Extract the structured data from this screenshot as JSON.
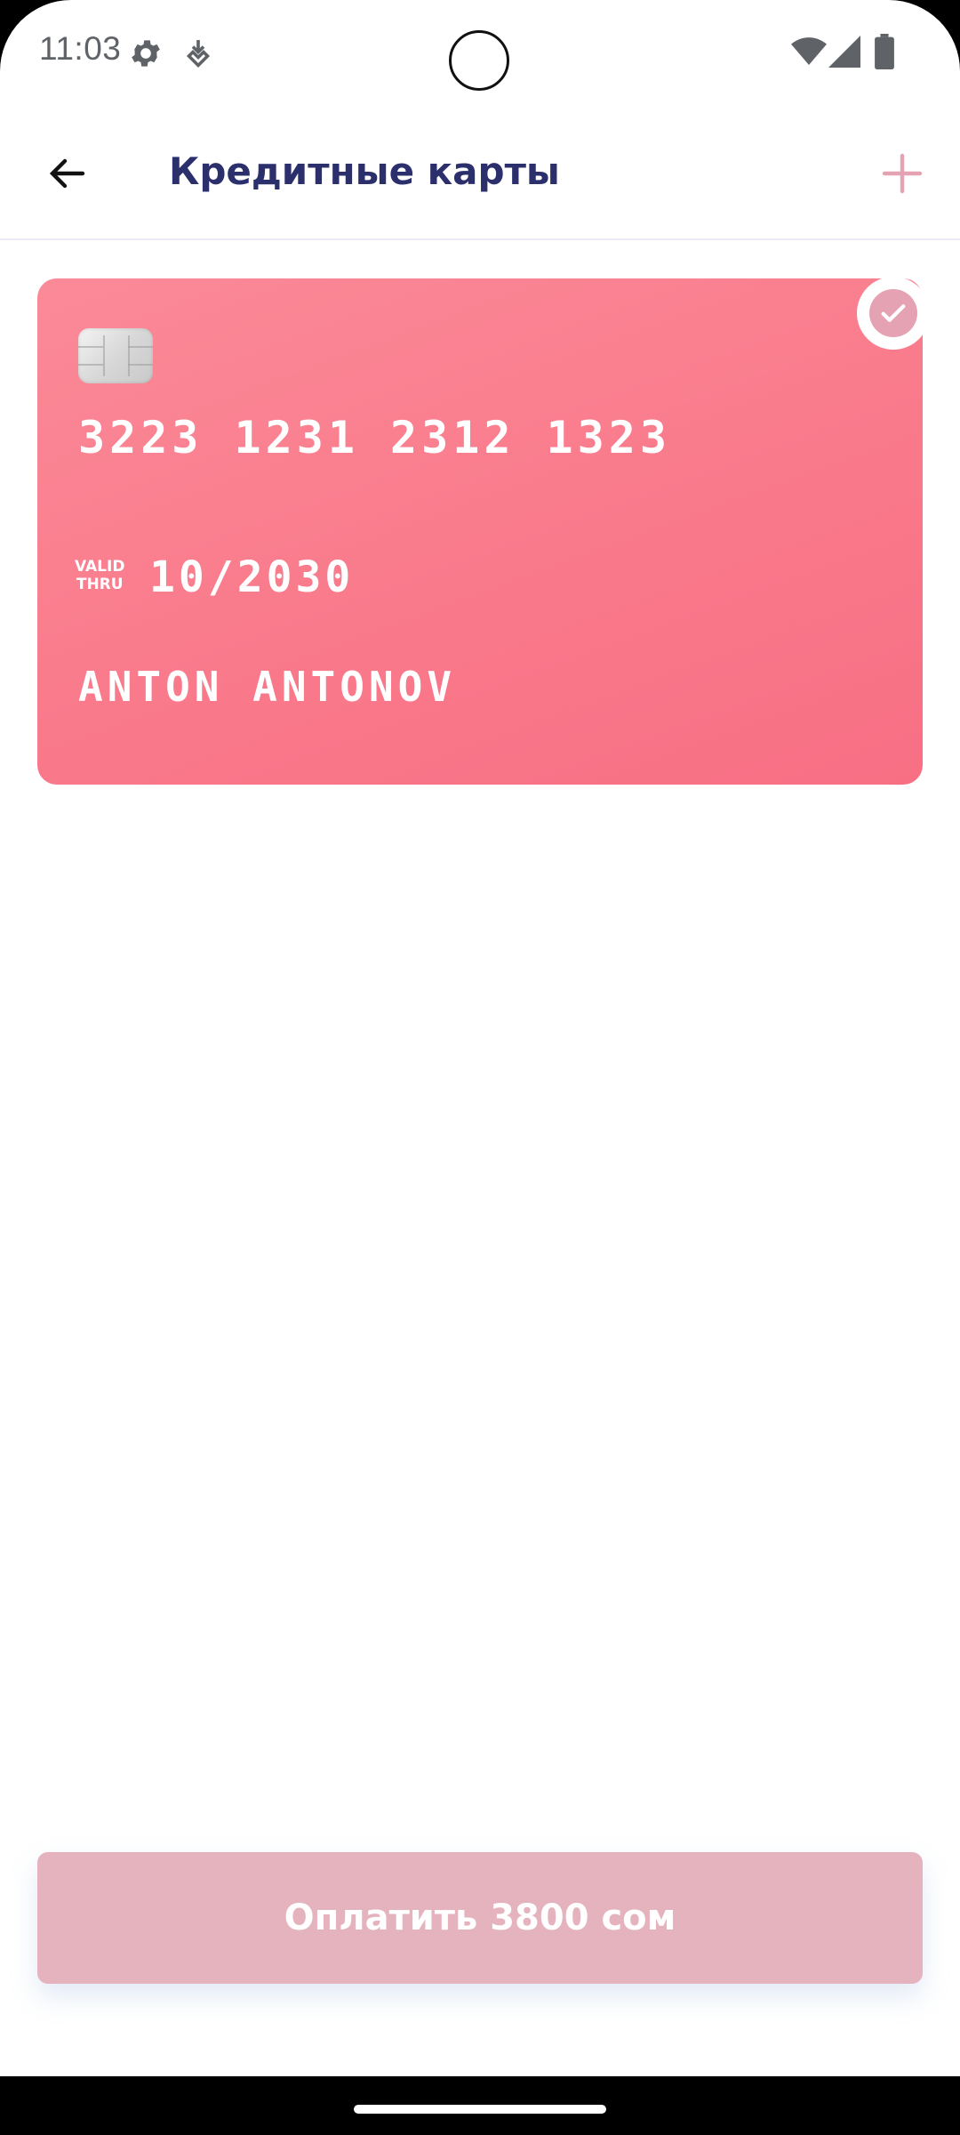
{
  "status_bar": {
    "time": "11:03",
    "icons": [
      "gear-icon",
      "download-icon",
      "wifi-icon",
      "signal-icon",
      "battery-icon"
    ]
  },
  "app_bar": {
    "title": "Кредитные карты",
    "back_icon": "arrow-left-icon",
    "add_icon": "plus-icon"
  },
  "card": {
    "number": "3223 1231 2312 1323",
    "valid_label_line1": "VALID",
    "valid_label_line2": "THRU",
    "expiry": "10/2030",
    "holder": "ANTON ANTONOV",
    "selected": true
  },
  "pay_button": {
    "label": "Оплатить 3800 сом"
  },
  "colors": {
    "card_gradient_start": "#fb8a98",
    "card_gradient_end": "#f86f84",
    "title": "#2b2f6b",
    "accent": "#e5a2b3",
    "pay_button": "#e5b3bd"
  }
}
